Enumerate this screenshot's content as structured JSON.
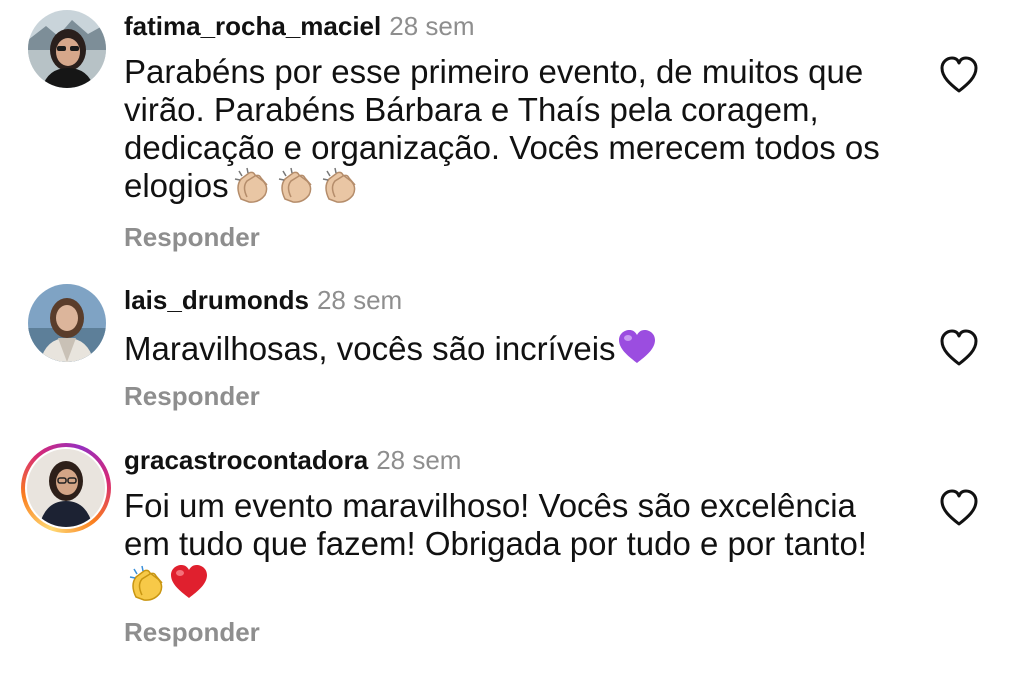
{
  "comments": [
    {
      "username": "fatima_rocha_maciel",
      "time": "28 sem",
      "text": "Parabéns por esse primeiro evento, de muitos que virão. Parabéns Bárbara e Thaís pela coragem, dedicação e organização. Vocês merecem todos os elogios",
      "emojis": [
        "clapping-hands-light",
        "clapping-hands-light",
        "clapping-hands-light"
      ],
      "reply_label": "Responder"
    },
    {
      "username": "lais_drumonds",
      "time": "28 sem",
      "text": "Maravilhosas, vocês são incríveis",
      "emojis": [
        "purple-heart"
      ],
      "reply_label": "Responder"
    },
    {
      "username": "gracastrocontadora",
      "time": "28 sem",
      "text": "Foi um evento maravilhoso! Vocês são excelência em tudo que fazem! Obrigada por tudo e por tanto!",
      "emojis": [
        "clapping-hands-yellow",
        "red-heart"
      ],
      "reply_label": "Responder"
    }
  ],
  "colors": {
    "text": "#111111",
    "muted": "#8e8e8e",
    "like_icon": "#111111"
  }
}
